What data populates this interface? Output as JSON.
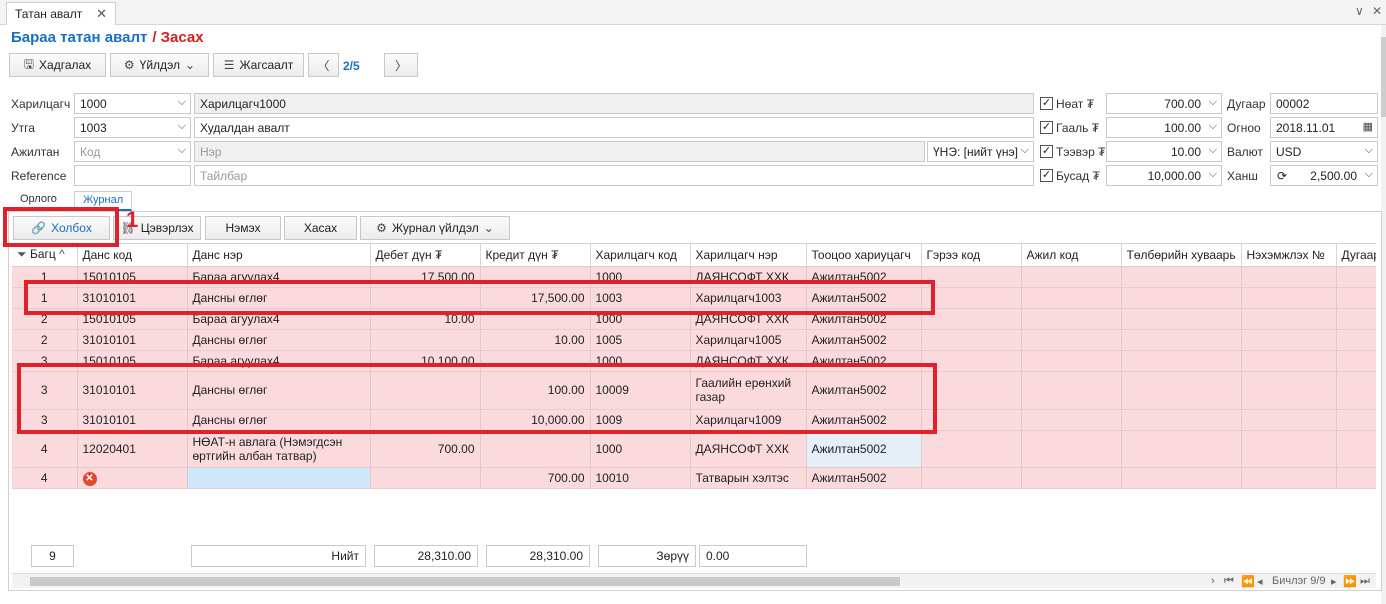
{
  "window": {
    "tab_title": "Татан авалт",
    "close_glyph": "✕",
    "controls": [
      "∨",
      "✕"
    ]
  },
  "header": {
    "title": "Бараа татан авалт",
    "subtitle": "/ Засах"
  },
  "toolbar": {
    "save": "Хадгалах",
    "actions": "Үйлдэл",
    "list": "Жагсаалт",
    "pager": "2/5"
  },
  "form": {
    "customer_label": "Харилцагч",
    "customer_code": "1000",
    "customer_name": "Харилцагч1000",
    "utga_label": "Утга",
    "utga_code": "1003",
    "utga_name": "Худалдан авалт",
    "employee_label": "Ажилтан",
    "employee_code_placeholder": "Код",
    "employee_name_placeholder": "Нэр",
    "price_mode": "ҮНЭ: [нийт үнэ]",
    "reference_label": "Reference",
    "description_placeholder": "Тайлбар",
    "vat_label": "Нөат ₮",
    "vat_value": "700.00",
    "customs_label": "Гааль ₮",
    "customs_value": "100.00",
    "transport_label": "Тээвэр ₮",
    "transport_value": "10.00",
    "other_label": "Бусад ₮",
    "other_value": "10,000.00",
    "number_label": "Дугаар",
    "number_value": "00002",
    "date_label": "Огноо",
    "date_value": "2018.11.01",
    "currency_label": "Валют",
    "currency_value": "USD",
    "rate_label": "Ханш",
    "rate_value": "2,500.00"
  },
  "subtabs": [
    "Орлого",
    "Журнал"
  ],
  "grid_toolbar": {
    "link": "Холбох",
    "unlink": "Цэвэрлэх",
    "add": "Нэмэх",
    "remove": "Хасах",
    "journal_actions": "Журнал үйлдэл"
  },
  "grid": {
    "columns": [
      "Багц",
      "Данс код",
      "Данс нэр",
      "Дебет дүн ₮",
      "Кредит дүн ₮",
      "Харилцагч код",
      "Харилцагч нэр",
      "Тооцоо хариуцагч",
      "Гэрээ код",
      "Ажил код",
      "Төлбөрийн хуваарь",
      "Нэхэмжлэх №",
      "Дугаар"
    ],
    "rows": [
      {
        "batch": "1",
        "acct": "15010105",
        "name": "Бараа агуулах4",
        "debit": "17,500.00",
        "credit": "",
        "ccode": "1000",
        "cname": "ДАЯНСОФТ ХХК",
        "resp": "Ажилтан5002"
      },
      {
        "batch": "1",
        "acct": "31010101",
        "name": "Дансны өглөг",
        "debit": "",
        "credit": "17,500.00",
        "ccode": "1003",
        "cname": "Харилцагч1003",
        "resp": "Ажилтан5002"
      },
      {
        "batch": "2",
        "acct": "15010105",
        "name": "Бараа агуулах4",
        "debit": "10.00",
        "credit": "",
        "ccode": "1000",
        "cname": "ДАЯНСОФТ ХХК",
        "resp": "Ажилтан5002"
      },
      {
        "batch": "2",
        "acct": "31010101",
        "name": "Дансны өглөг",
        "debit": "",
        "credit": "10.00",
        "ccode": "1005",
        "cname": "Харилцагч1005",
        "resp": "Ажилтан5002"
      },
      {
        "batch": "3",
        "acct": "15010105",
        "name": "Бараа агуулах4",
        "debit": "10,100.00",
        "credit": "",
        "ccode": "1000",
        "cname": "ДАЯНСОФТ ХХК",
        "resp": "Ажилтан5002"
      },
      {
        "batch": "3",
        "acct": "31010101",
        "name": "Дансны өглөг",
        "debit": "",
        "credit": "100.00",
        "ccode": "10009",
        "cname": "Гаалийн ерөнхий газар",
        "resp": "Ажилтан5002"
      },
      {
        "batch": "3",
        "acct": "31010101",
        "name": "Дансны өглөг",
        "debit": "",
        "credit": "10,000.00",
        "ccode": "1009",
        "cname": "Харилцагч1009",
        "resp": "Ажилтан5002"
      },
      {
        "batch": "4",
        "acct": "12020401",
        "name": "НӨАТ-н авлага (Нэмэгдсэн өртгийн албан татвар)",
        "debit": "700.00",
        "credit": "",
        "ccode": "1000",
        "cname": "ДАЯНСОФТ ХХК",
        "resp": "Ажилтан5002"
      },
      {
        "batch": "4",
        "acct": "",
        "name": "",
        "debit": "",
        "credit": "700.00",
        "ccode": "10010",
        "cname": "Татварын хэлтэс",
        "resp": "Ажилтан5002"
      }
    ]
  },
  "footer": {
    "count": "9",
    "total_label": "Нийт",
    "debit_total": "28,310.00",
    "credit_total": "28,310.00",
    "diff_label": "Зөрүү",
    "diff_value": "0.00"
  },
  "navigator": {
    "record_text": "Бичлэг 9/9"
  },
  "annotation": {
    "step": "1",
    "color": "#e1202a"
  },
  "colors": {
    "title_blue": "#1a6fc4",
    "subtitle_red": "#d42020",
    "row_error_pink": "#fadadd"
  }
}
